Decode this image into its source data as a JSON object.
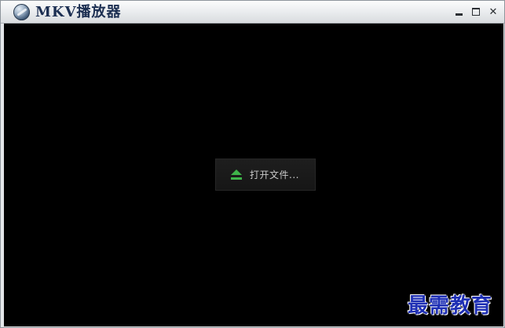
{
  "window": {
    "title": "MKV播放器",
    "controls": {
      "minimize_icon": "minimize-icon",
      "maximize_icon": "maximize-icon",
      "close_glyph": "✕"
    }
  },
  "player": {
    "open_file_label": "打开文件...",
    "open_file_icon": "eject-icon",
    "accent_color": "#3fb34a",
    "background_color": "#000000"
  },
  "watermark": {
    "text": "最需教育",
    "color": "#1e2fb4"
  }
}
